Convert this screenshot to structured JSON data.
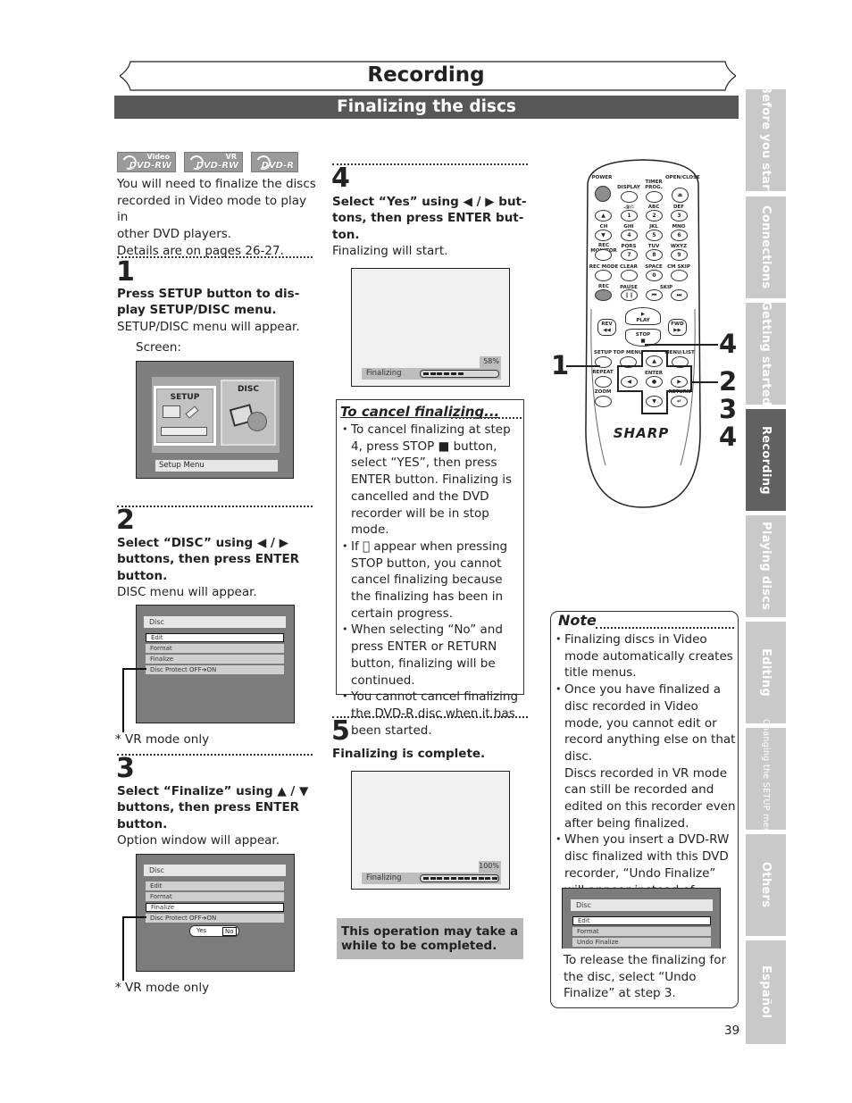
{
  "header": {
    "title": "Recording",
    "section": "Finalizing the discs"
  },
  "side_tabs": [
    {
      "label": "Before you start",
      "active": false
    },
    {
      "label": "Connections",
      "active": false
    },
    {
      "label": "Getting started",
      "active": false
    },
    {
      "label": "Recording",
      "active": true
    },
    {
      "label": "Playing discs",
      "active": false
    },
    {
      "label": "Editing",
      "active": false
    },
    {
      "label": "Changing the SETUP menu",
      "active": false
    },
    {
      "label": "Others",
      "active": false
    },
    {
      "label": "Español",
      "active": false
    }
  ],
  "disc_logos": [
    {
      "top": "Video",
      "main": "DVD-RW"
    },
    {
      "top": "VR",
      "main": "DVD-RW"
    },
    {
      "top": "",
      "main": "DVD-R"
    }
  ],
  "intro": {
    "line1": "You will need to finalize the discs",
    "line2": "recorded in Video mode to play in",
    "line3": "other DVD players.",
    "line4": "Details are on pages 26-27."
  },
  "steps": {
    "s1": {
      "number": "1",
      "instruction_l1": "Press SETUP button to dis-",
      "instruction_l2": "play SETUP/DISC menu.",
      "result": "SETUP/DISC menu will appear.",
      "screen_label": "Screen:",
      "screen": {
        "setup_label": "SETUP",
        "disc_label": "DISC",
        "footer": "Setup Menu"
      }
    },
    "s2": {
      "number": "2",
      "instruction_l1": "Select “DISC” using ◀ / ▶",
      "instruction_l2": "buttons, then press ENTER",
      "instruction_l3": "button.",
      "result": "DISC menu will appear.",
      "screen": {
        "title": "Disc",
        "items": [
          "Edit",
          "Format",
          "Finalize",
          "Disc Protect OFF➔ON"
        ],
        "selected": "Edit"
      },
      "footnote": "* VR mode only"
    },
    "s3": {
      "number": "3",
      "instruction_l1": "Select “Finalize” using ▲ / ▼",
      "instruction_l2": "buttons, then press ENTER",
      "instruction_l3": "button.",
      "result": "Option window will appear.",
      "screen": {
        "title": "Disc",
        "items": [
          "Edit",
          "Format",
          "Finalize",
          "Disc Protect OFF➔ON"
        ],
        "selected": "Finalize",
        "options": [
          "Yes",
          "No"
        ],
        "selected_option": "No"
      },
      "footnote": "* VR mode only"
    },
    "s4": {
      "number": "4",
      "instruction_l1": "Select “Yes” using ◀ / ▶ but-",
      "instruction_l2": "tons, then press ENTER but-",
      "instruction_l3": "ton.",
      "result": "Finalizing will start.",
      "screen": {
        "label": "Finalizing",
        "percent_text": "58%",
        "progress": 0.58
      }
    },
    "s5": {
      "number": "5",
      "instruction": "Finalizing is complete.",
      "screen": {
        "label": "Finalizing",
        "percent_text": "100%",
        "progress": 1.0
      }
    }
  },
  "cancel_box": {
    "title": "To cancel finalizing...",
    "bullets": [
      "To cancel finalizing at step 4, press STOP ■ button, select “YES”, then press ENTER button. Finalizing is cancelled and the DVD recorder will be in stop mode.",
      "If ⃠ appear when pressing STOP button, you cannot cancel finalizing because the finalizing has been in certain progress.",
      "When selecting “No” and press ENTER or RETURN button, finalizing will be continued.",
      "You cannot cancel finalizing the DVD-R disc when it has been started."
    ]
  },
  "callout": "This operation may take a while to be completed.",
  "note": {
    "title": "Note",
    "bullets": [
      "Finalizing discs in Video mode automatically creates title menus.",
      "Once you have finalized a disc recorded in Video mode, you cannot edit or record anything else on that disc.",
      "When you insert a DVD-RW disc finalized with this DVD recorder, “Undo Finalize” will appear instead of  “Finalize”."
    ],
    "para": "Discs recorded in VR mode can still be recorded and edited on this recorder even after being finalized.",
    "screen": {
      "title": "Disc",
      "items": [
        "Edit",
        "Format",
        "Undo Finalize"
      ],
      "selected": "Edit"
    },
    "footer_text": "To release the finalizing for the disc, select “Undo Finalize” at step 3."
  },
  "remote": {
    "brand": "SHARP",
    "labels": {
      "power": "POWER",
      "display": "DISPLAY",
      "timer": "TIMER PROG.",
      "open_close": "OPEN/CLOSE",
      "k1": "1",
      "k2": "2",
      "k3": "3",
      "k4": "4",
      "k5": "5",
      "k6": "6",
      "k7": "7",
      "k8": "8",
      "k9": "9",
      "k0": "0",
      "l1": ".@/:",
      "l2": "ABC",
      "l3": "DEF",
      "l4": "GHI",
      "l5": "JKL",
      "l6": "MNO",
      "l7": "PQRS",
      "l8": "TUV",
      "l9": "WXYZ",
      "ch": "CH",
      "rec_monitor": "REC MONITOR",
      "rec_mode": "REC MODE",
      "clear": "CLEAR",
      "space": "SPACE",
      "cm_skip": "CM SKIP",
      "rec": "REC",
      "pause": "PAUSE",
      "skip": "SKIP",
      "play": "PLAY",
      "stop": "STOP",
      "rev": "REV",
      "fwd": "FWD",
      "setup": "SETUP",
      "top_menu": "TOP MENU",
      "menu_list": "MENU/LIST",
      "repeat": "REPEAT",
      "enter": "ENTER",
      "zoom": "ZOOM",
      "return": "RETURN"
    },
    "callouts": {
      "left": "1",
      "stop": "4",
      "dpad_a": "2",
      "dpad_b": "3",
      "dpad_c": "4"
    }
  },
  "page_number": "39"
}
